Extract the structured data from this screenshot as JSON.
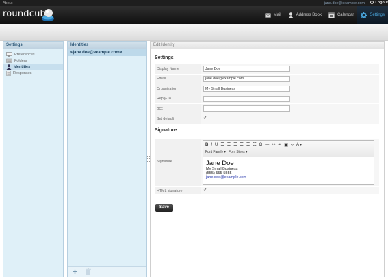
{
  "topline": {
    "about": "About",
    "username": "jane.doe@example.com",
    "logout": "Logout"
  },
  "header": {
    "logo_text": "roundcube"
  },
  "tasks": [
    {
      "label": "Mail",
      "icon": "mail-icon"
    },
    {
      "label": "Address Book",
      "icon": "address-book-icon"
    },
    {
      "label": "Calendar",
      "icon": "calendar-icon"
    },
    {
      "label": "Settings",
      "icon": "gear-icon",
      "active": true
    }
  ],
  "settings_panel": {
    "title": "Settings",
    "items": [
      {
        "label": "Preferences",
        "icon": "preferences-icon"
      },
      {
        "label": "Folders",
        "icon": "folders-icon"
      },
      {
        "label": "Identities",
        "icon": "identities-icon",
        "selected": true
      },
      {
        "label": "Responses",
        "icon": "responses-icon"
      }
    ]
  },
  "identities_panel": {
    "title": "Identities",
    "items": [
      {
        "label": "<jane.doe@example.com>"
      }
    ]
  },
  "edit": {
    "title": "Edit Identity",
    "settings_heading": "Settings",
    "fields": {
      "display_name": {
        "label": "Display Name",
        "value": "Jane Doe"
      },
      "email": {
        "label": "Email",
        "value": "jane.doe@example.com"
      },
      "organization": {
        "label": "Organization",
        "value": "My Small Business"
      },
      "reply_to": {
        "label": "Reply-To",
        "value": ""
      },
      "bcc": {
        "label": "Bcc",
        "value": ""
      },
      "set_default": {
        "label": "Set default",
        "checked": true
      }
    },
    "signature_heading": "Signature",
    "signature_label": "Signature",
    "toolbar": {
      "bold": "B",
      "italic": "I",
      "underline": "U",
      "font_family": "Font Family",
      "font_sizes": "Font Sizes"
    },
    "signature": {
      "name": "Jane Doe",
      "organization": "My Small Business",
      "phone": "(555) 555-5555",
      "email": "jane.doe@example.com"
    },
    "html_signature": {
      "label": "HTML signature",
      "checked": true
    },
    "save_label": "Save"
  }
}
